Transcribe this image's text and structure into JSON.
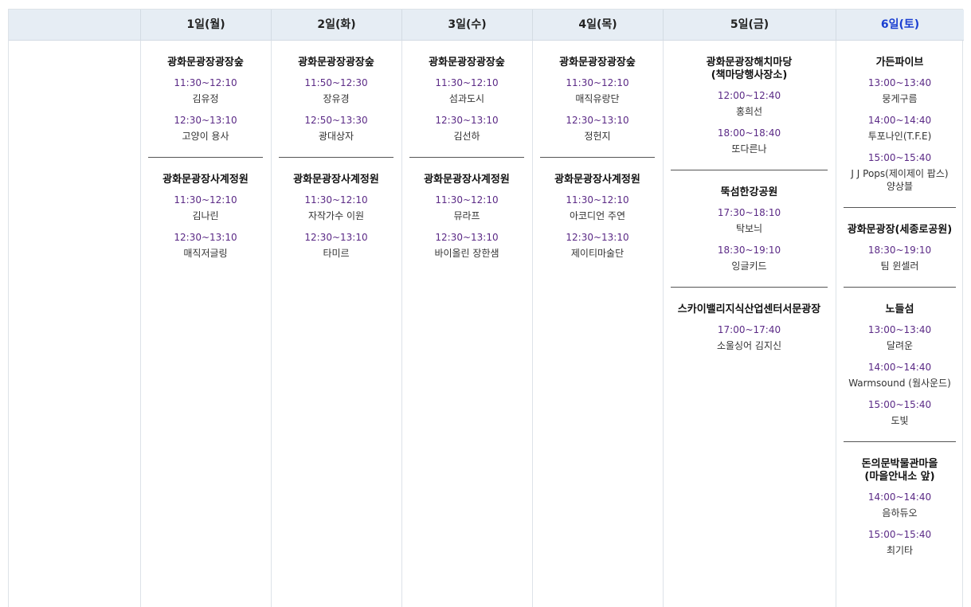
{
  "days": [
    {
      "label": "1일(월)",
      "saturday": false,
      "venues": [
        {
          "name": "광화문광장광장숲",
          "slots": [
            {
              "time": "11:30~12:10",
              "performer": "김유정"
            },
            {
              "time": "12:30~13:10",
              "performer": "고양이 용사"
            }
          ]
        },
        {
          "name": "광화문광장사계정원",
          "slots": [
            {
              "time": "11:30~12:10",
              "performer": "김나린"
            },
            {
              "time": "12:30~13:10",
              "performer": "매직저글링"
            }
          ]
        }
      ]
    },
    {
      "label": "2일(화)",
      "saturday": false,
      "venues": [
        {
          "name": "광화문광장광장숲",
          "slots": [
            {
              "time": "11:50~12:30",
              "performer": "장유경"
            },
            {
              "time": "12:50~13:30",
              "performer": "광대상자"
            }
          ]
        },
        {
          "name": "광화문광장사계정원",
          "slots": [
            {
              "time": "11:30~12:10",
              "performer": "자작가수 이원"
            },
            {
              "time": "12:30~13:10",
              "performer": "타미르"
            }
          ]
        }
      ]
    },
    {
      "label": "3일(수)",
      "saturday": false,
      "venues": [
        {
          "name": "광화문광장광장숲",
          "slots": [
            {
              "time": "11:30~12:10",
              "performer": "섬과도시"
            },
            {
              "time": "12:30~13:10",
              "performer": "김선하"
            }
          ]
        },
        {
          "name": "광화문광장사계정원",
          "slots": [
            {
              "time": "11:30~12:10",
              "performer": "뮤라프"
            },
            {
              "time": "12:30~13:10",
              "performer": "바이올린 장한샘"
            }
          ]
        }
      ]
    },
    {
      "label": "4일(목)",
      "saturday": false,
      "venues": [
        {
          "name": "광화문광장광장숲",
          "slots": [
            {
              "time": "11:30~12:10",
              "performer": "매직유랑단"
            },
            {
              "time": "12:30~13:10",
              "performer": "정헌지"
            }
          ]
        },
        {
          "name": "광화문광장사계정원",
          "slots": [
            {
              "time": "11:30~12:10",
              "performer": "아코디언 주연"
            },
            {
              "time": "12:30~13:10",
              "performer": "제이티마술단"
            }
          ]
        }
      ]
    },
    {
      "label": "5일(금)",
      "saturday": false,
      "venues": [
        {
          "name": "광화문광장해치마당\n(책마당행사장소)",
          "slots": [
            {
              "time": "12:00~12:40",
              "performer": "홍희선"
            },
            {
              "time": "18:00~18:40",
              "performer": "또다른나"
            }
          ]
        },
        {
          "name": "뚝섬한강공원",
          "slots": [
            {
              "time": "17:30~18:10",
              "performer": "탁보늬"
            },
            {
              "time": "18:30~19:10",
              "performer": "잉글키드"
            }
          ]
        },
        {
          "name": "스카이밸리지식산업센터서문광장",
          "slots": [
            {
              "time": "17:00~17:40",
              "performer": "소울싱어 김지신"
            }
          ]
        }
      ]
    },
    {
      "label": "6일(토)",
      "saturday": true,
      "venues": [
        {
          "name": "가든파이브",
          "slots": [
            {
              "time": "13:00~13:40",
              "performer": "뭉게구름"
            },
            {
              "time": "14:00~14:40",
              "performer": "투포나인(T.F.E)"
            },
            {
              "time": "15:00~15:40",
              "performer": "J J Pops(제이제이 팝스)\n양상블"
            }
          ]
        },
        {
          "name": "광화문광장(세종로공원)",
          "slots": [
            {
              "time": "18:30~19:10",
              "performer": "팀 윈셀러"
            }
          ]
        },
        {
          "name": "노들섬",
          "slots": [
            {
              "time": "13:00~13:40",
              "performer": "달려운"
            },
            {
              "time": "14:00~14:40",
              "performer": "Warmsound (웜사운드)"
            },
            {
              "time": "15:00~15:40",
              "performer": "도빛"
            }
          ]
        },
        {
          "name": "돈의문박물관마을\n(마을안내소 앞)",
          "slots": [
            {
              "time": "14:00~14:40",
              "performer": "음하듀오"
            },
            {
              "time": "15:00~15:40",
              "performer": "최기타"
            }
          ]
        }
      ]
    }
  ],
  "colors": {
    "header_bg": "#e6edf4",
    "time_text": "#5b2a86",
    "saturday_text": "#1a3fd1"
  }
}
